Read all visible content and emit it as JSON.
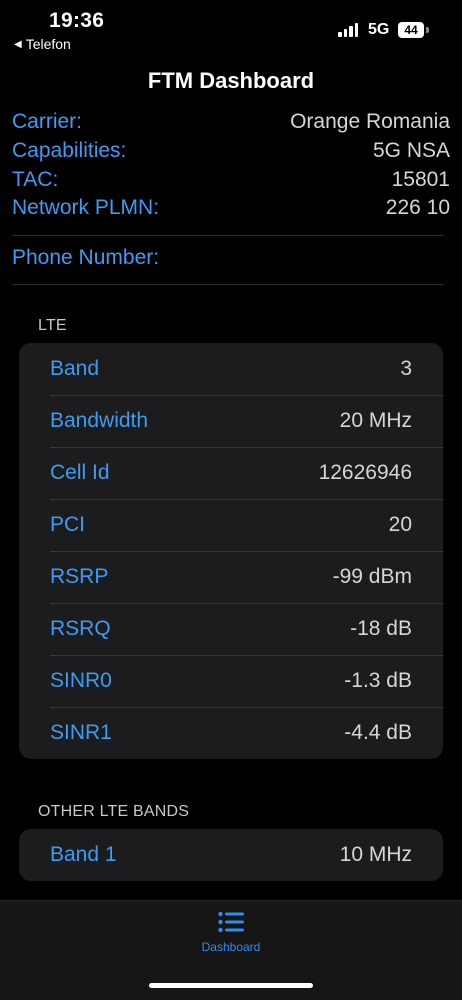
{
  "status": {
    "time": "19:36",
    "back_label": "Telefon",
    "network": "5G",
    "battery": "44"
  },
  "title": "FTM Dashboard",
  "info": [
    {
      "label": "Carrier:",
      "value": "Orange Romania"
    },
    {
      "label": "Capabilities:",
      "value": "5G NSA"
    },
    {
      "label": "TAC:",
      "value": "15801"
    },
    {
      "label": "Network PLMN:",
      "value": "226 10"
    }
  ],
  "phone": {
    "label": "Phone Number:",
    "value": ""
  },
  "lte": {
    "header": "LTE",
    "rows": [
      {
        "label": "Band",
        "value": "3"
      },
      {
        "label": "Bandwidth",
        "value": "20 MHz"
      },
      {
        "label": "Cell Id",
        "value": "12626946"
      },
      {
        "label": "PCI",
        "value": "20"
      },
      {
        "label": "RSRP",
        "value": "-99 dBm"
      },
      {
        "label": "RSRQ",
        "value": "-18 dB"
      },
      {
        "label": "SINR0",
        "value": "-1.3 dB"
      },
      {
        "label": "SINR1",
        "value": "-4.4 dB"
      }
    ]
  },
  "other": {
    "header": "OTHER LTE BANDS",
    "rows": [
      {
        "label": "Band 1",
        "value": "10 MHz"
      }
    ]
  },
  "tabbar": {
    "label": "Dashboard",
    "icon": "list-icon"
  },
  "colors": {
    "accent": "#3d9bf3",
    "background": "#000000",
    "card": "#1c1c1e"
  }
}
